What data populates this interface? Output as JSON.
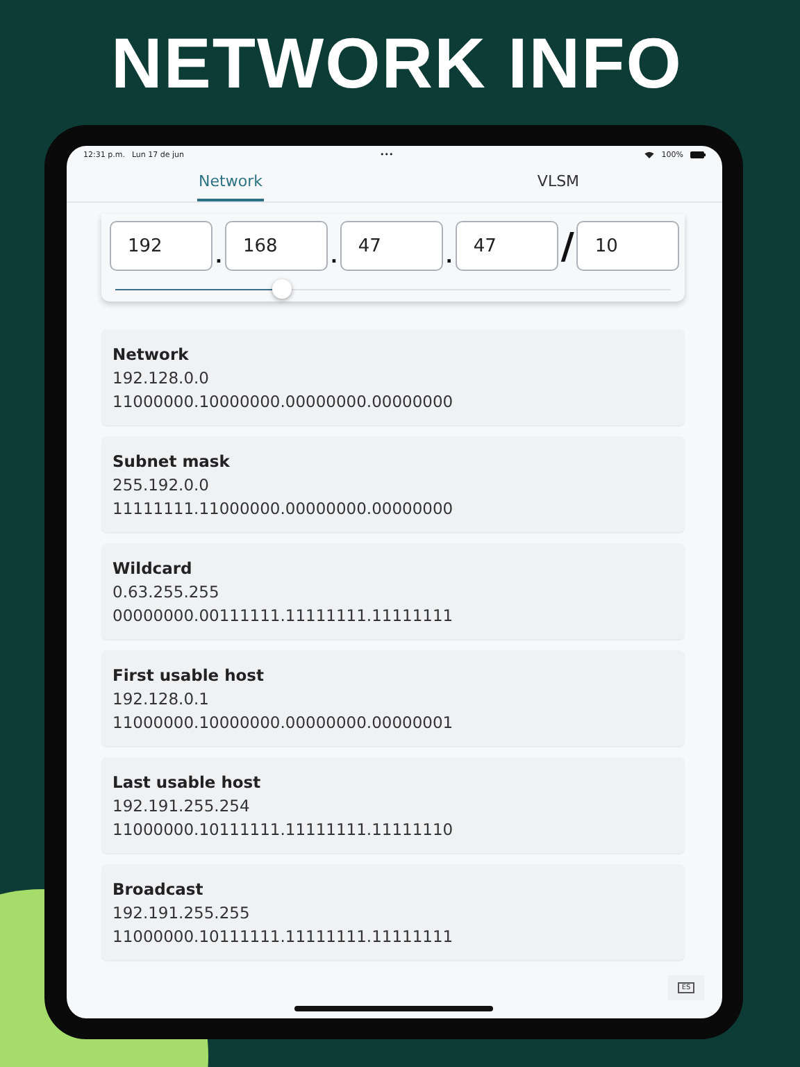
{
  "headline": "NETWORK INFO",
  "status_bar": {
    "time": "12:31 p.m.",
    "date": "Lun 17 de jun",
    "dots": "•••",
    "battery": "100%"
  },
  "tabs": [
    {
      "label": "Network",
      "selected": true
    },
    {
      "label": "VLSM",
      "selected": false
    }
  ],
  "address": {
    "octets": [
      "192",
      "168",
      "47",
      "47"
    ],
    "separator": ".",
    "slash": "/",
    "prefix": "10",
    "level": 0.3
  },
  "results": [
    {
      "title": "Network",
      "decimal": "192.128.0.0",
      "binary": "11000000.10000000.00000000.00000000"
    },
    {
      "title": "Subnet mask",
      "decimal": "255.192.0.0",
      "binary": "11111111.11000000.00000000.00000000"
    },
    {
      "title": "Wildcard",
      "decimal": "0.63.255.255",
      "binary": "00000000.00111111.11111111.11111111"
    },
    {
      "title": "First usable host",
      "decimal": "192.128.0.1",
      "binary": "11000000.10000000.00000000.00000001"
    },
    {
      "title": "Last usable host",
      "decimal": "192.191.255.254",
      "binary": "11000000.10111111.11111111.11111110"
    },
    {
      "title": "Broadcast",
      "decimal": "192.191.255.255",
      "binary": "11000000.10111111.11111111.11111111"
    }
  ],
  "language_button": "ES"
}
